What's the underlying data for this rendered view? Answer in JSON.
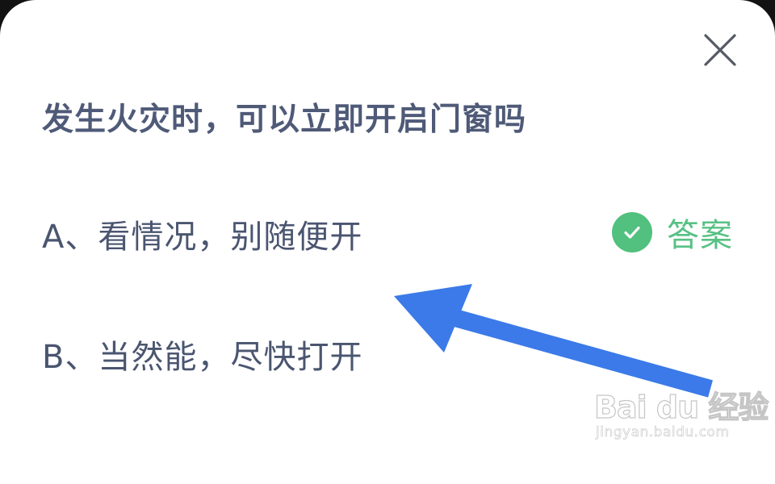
{
  "quiz": {
    "question": "发生火灾时，可以立即开启门窗吗",
    "options": [
      {
        "text": "A、看情况，别随便开",
        "is_answer": true
      },
      {
        "text": "B、当然能，尽快打开",
        "is_answer": false
      }
    ],
    "answer_label": "答案",
    "icons": {
      "close": "close-icon",
      "check": "check-circle-icon"
    }
  },
  "annotation": {
    "type": "arrow",
    "color": "#3b7ae8"
  },
  "watermark": {
    "logo_text": "Bai du 经验",
    "url": "jingyan.baidu.com"
  },
  "colors": {
    "question_text": "#4f5a78",
    "option_text": "#4a5570",
    "answer_green": "#57c184",
    "check_green": "#52c07e",
    "card_background": "#ffffff"
  }
}
